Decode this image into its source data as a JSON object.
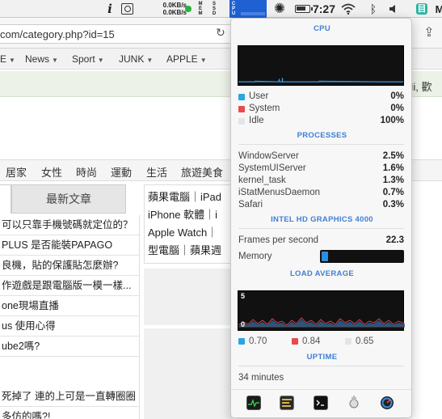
{
  "menubar": {
    "info_glyph": "i",
    "net_up": "0.0KB/s",
    "net_down": "0.0KB/s",
    "mem_label": "MEM",
    "disk_label": "SSD",
    "cpu_label": "CPU",
    "gpu_glyph": "✺",
    "clock": "7:27",
    "bt_glyph": "ᛒ",
    "app1_glyph": "目",
    "app2_glyph": "M"
  },
  "browser": {
    "url": "com/category.php?id=15",
    "reload_glyph": "↻",
    "share_glyph": "⇪",
    "nav_items": [
      {
        "label": "E"
      },
      {
        "label": "News"
      },
      {
        "label": "Sport"
      },
      {
        "label": "JUNK"
      },
      {
        "label": "APPLE"
      }
    ],
    "greeting": "Hi, 歡",
    "categories": [
      "居家",
      "女性",
      "時尚",
      "運動",
      "生活",
      "旅遊美食"
    ],
    "latest_tab": "最新文章",
    "articles": [
      "可以只靠手機號碼就定位的？",
      " PLUS 是否能裝PAPAGO",
      "良機，貼的保護貼怎麼辦?",
      "作遊戲是跟電腦版一模一樣...",
      "one現場直播",
      "us 使用心得",
      "ube2嗎?",
      "",
      "死掉了 連的上可是一直轉圈圈",
      "多仿的嗎?!"
    ],
    "category_lines": [
      "蘋果電腦｜iPad",
      "iPhone 軟體｜i",
      "Apple Watch｜",
      "型電腦｜蘋果週"
    ]
  },
  "istat": {
    "cpu_title": "CPU",
    "cpu_stats": [
      {
        "label": "User",
        "value": "0%",
        "color": "#2aa7e0"
      },
      {
        "label": "System",
        "value": "0%",
        "color": "#e84b4b"
      },
      {
        "label": "Idle",
        "value": "100%",
        "color": "#e4e4e4"
      }
    ],
    "processes_title": "PROCESSES",
    "processes": [
      {
        "name": "WindowServer",
        "value": "2.5%"
      },
      {
        "name": "SystemUIServer",
        "value": "1.6%"
      },
      {
        "name": "kernel_task",
        "value": "1.3%"
      },
      {
        "name": "iStatMenusDaemon",
        "value": "0.7%"
      },
      {
        "name": "Safari",
        "value": "0.3%"
      }
    ],
    "gpu_title": "INTEL HD GRAPHICS 4000",
    "fps_label": "Frames per second",
    "fps_value": "22.3",
    "memory_label": "Memory",
    "memory_fraction": 0.05,
    "load_title": "LOAD AVERAGE",
    "load_graph_max": "5",
    "load_graph_min": "0",
    "load_legend": [
      {
        "value": "0.70",
        "color": "#2aa7e0"
      },
      {
        "value": "0.84",
        "color": "#e84b4b"
      },
      {
        "value": "0.65",
        "color": "#e4e4e4"
      }
    ],
    "uptime_title": "UPTIME",
    "uptime_value": "34 minutes",
    "footer_icons": [
      "activity-monitor-icon",
      "console-icon",
      "terminal-icon",
      "system-info-icon",
      "istat-icon"
    ]
  }
}
